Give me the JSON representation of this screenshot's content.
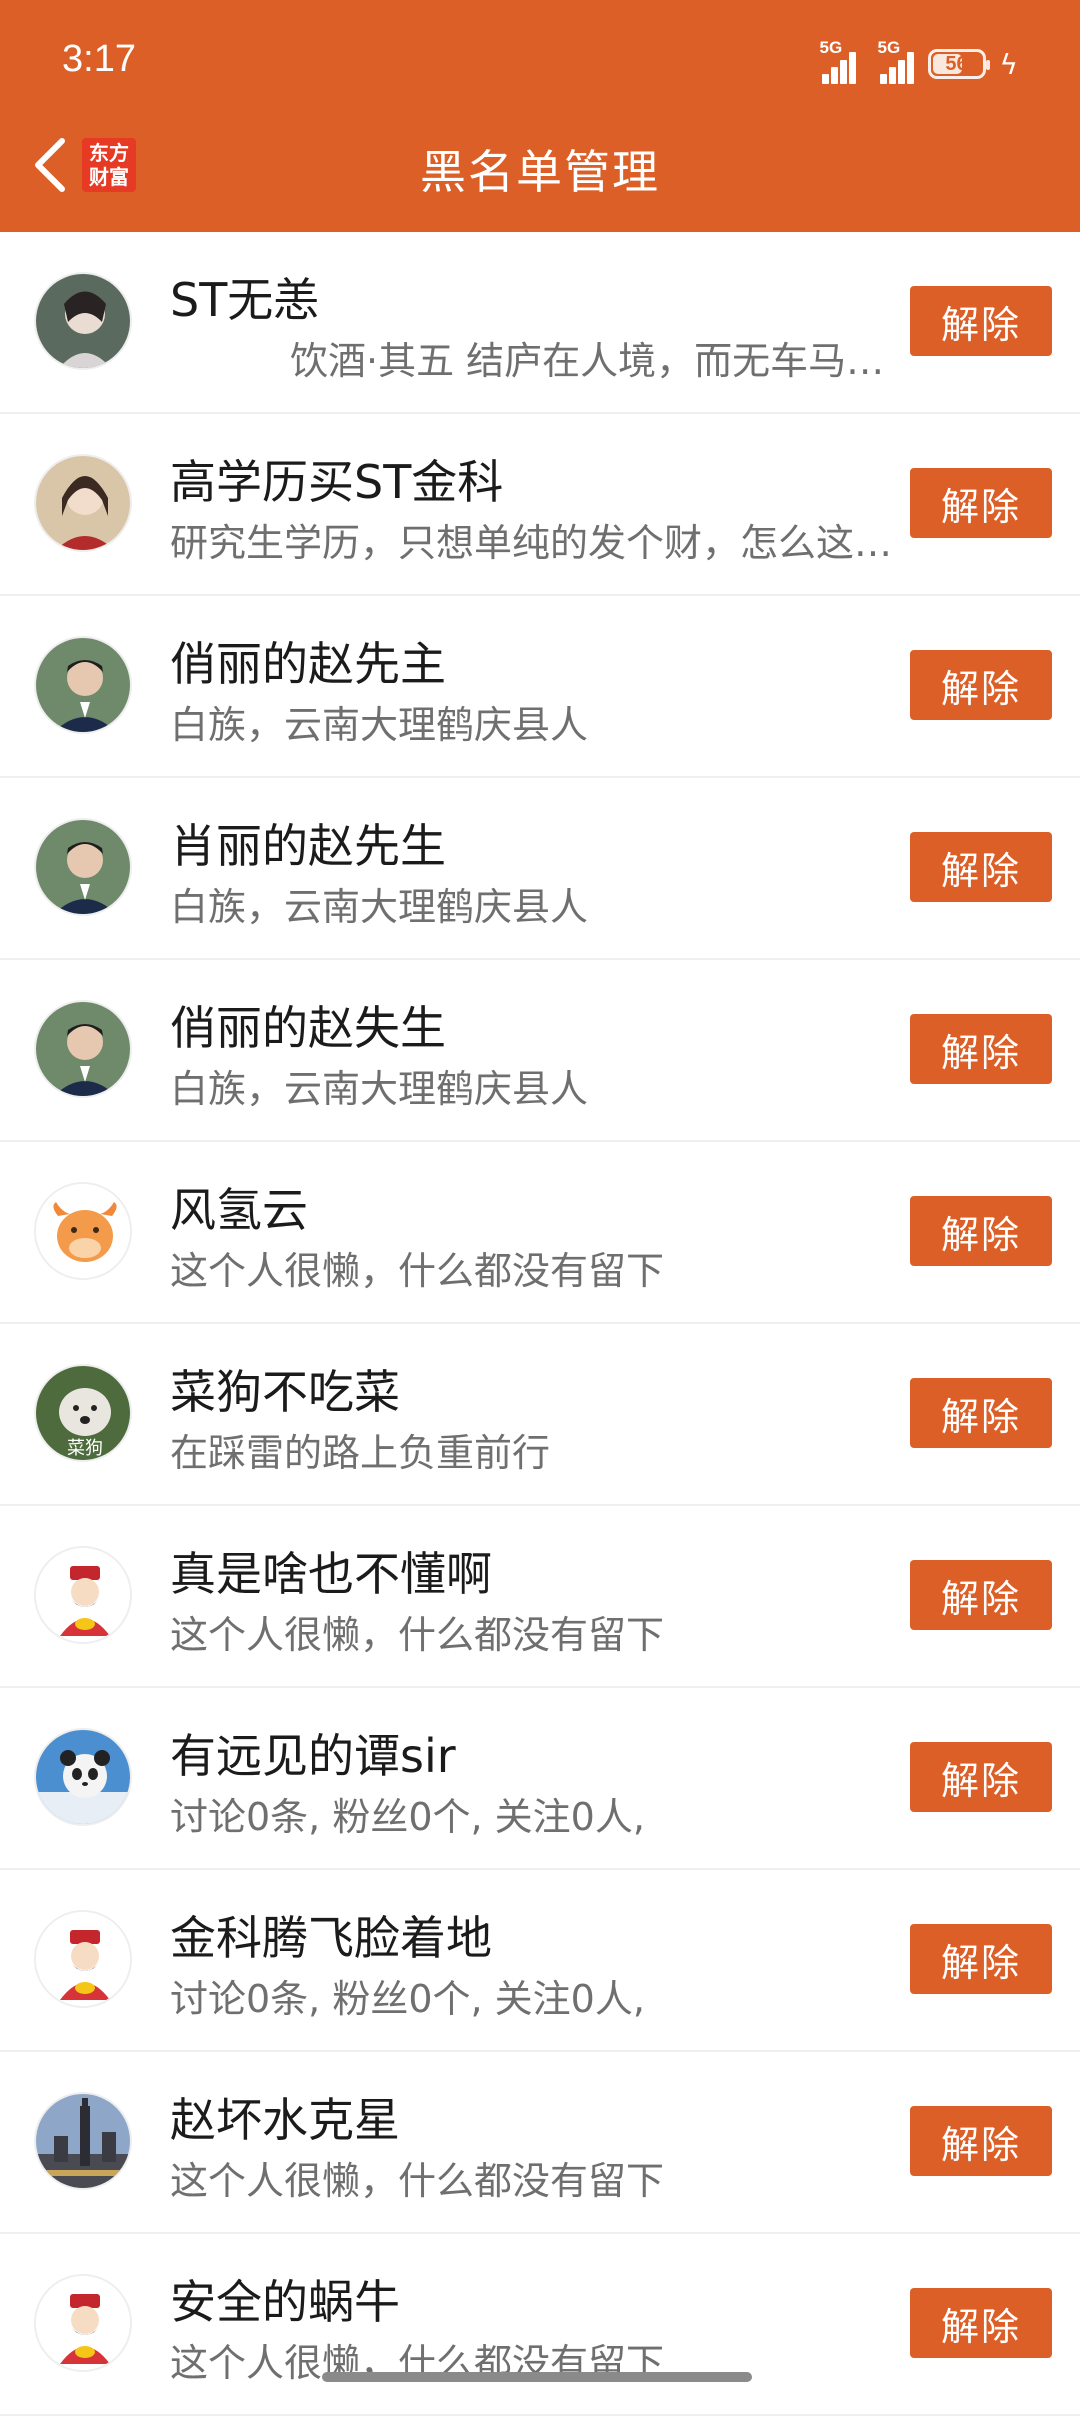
{
  "status": {
    "time": "3:17",
    "net1": "5G",
    "net2": "5G",
    "battery": "56"
  },
  "header": {
    "title": "黑名单管理",
    "logo_line1": "东方",
    "logo_line2": "财富"
  },
  "colors": {
    "accent": "#DC5F27"
  },
  "users": [
    {
      "name": "ST无恙",
      "desc": "饮酒·其五 结庐在人境，而无车马喧。",
      "button": "解除",
      "avatar": "portrait-anime-icon"
    },
    {
      "name": "高学历买ST金科",
      "desc": "研究生学历，只想单纯的发个财，怎么这么难",
      "button": "解除",
      "avatar": "portrait-woman-icon"
    },
    {
      "name": "俏丽的赵先主",
      "desc": "白族，云南大理鹤庆县人",
      "button": "解除",
      "avatar": "portrait-man-icon"
    },
    {
      "name": "肖丽的赵先生",
      "desc": "白族，云南大理鹤庆县人",
      "button": "解除",
      "avatar": "portrait-man-icon"
    },
    {
      "name": "俏丽的赵失生",
      "desc": "白族，云南大理鹤庆县人",
      "button": "解除",
      "avatar": "portrait-man-icon"
    },
    {
      "name": "风氢云",
      "desc": "这个人很懒，什么都没有留下",
      "button": "解除",
      "avatar": "bull-icon"
    },
    {
      "name": "菜狗不吃菜",
      "desc": "在踩雷的路上负重前行",
      "button": "解除",
      "avatar": "dog-icon",
      "avatar_text": "菜狗"
    },
    {
      "name": "真是啥也不懂啊",
      "desc": "这个人很懒，什么都没有留下",
      "button": "解除",
      "avatar": "fortune-god-icon"
    },
    {
      "name": "有远见的谭sir",
      "desc": "讨论0条, 粉丝0个, 关注0人,",
      "button": "解除",
      "avatar": "panda-icon"
    },
    {
      "name": "金科腾飞脸着地",
      "desc": "讨论0条, 粉丝0个, 关注0人,",
      "button": "解除",
      "avatar": "fortune-god-icon"
    },
    {
      "name": "赵坏水克星",
      "desc": "这个人很懒，什么都没有留下",
      "button": "解除",
      "avatar": "city-tower-icon"
    },
    {
      "name": "安全的蜗牛",
      "desc": "这个人很懒，什么都没有留下",
      "button": "解除",
      "avatar": "fortune-god-icon"
    }
  ]
}
